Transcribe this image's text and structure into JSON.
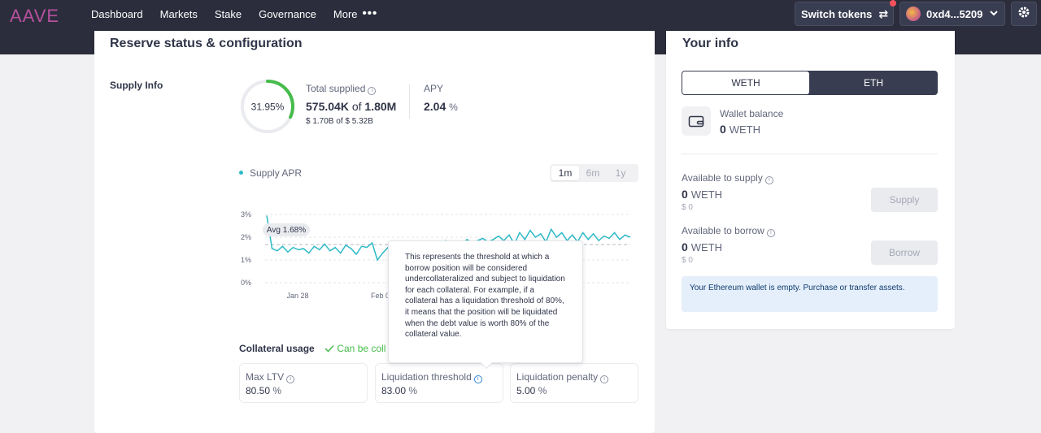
{
  "header": {
    "logo": "AAVE",
    "nav": [
      "Dashboard",
      "Markets",
      "Stake",
      "Governance"
    ],
    "more_label": "More",
    "switch_tokens_label": "Switch tokens",
    "wallet_address": "0xd4...5209"
  },
  "reserve": {
    "title": "Reserve status & configuration",
    "supply_info_label": "Supply Info",
    "utilization": "31.95%",
    "utilization_fraction": 0.3195,
    "total_supplied_label": "Total supplied",
    "total_supplied_amount": "575.04K",
    "of_label": "of",
    "total_supplied_cap": "1.80M",
    "usd_amount": "$ 1.70B",
    "usd_cap": "$ 5.32B",
    "apy_label": "APY",
    "apy_value": "2.04",
    "percent_sign": "%"
  },
  "chart_data": {
    "type": "line",
    "legend": "Supply APR",
    "ranges": [
      "1m",
      "6m",
      "1y"
    ],
    "selected_range": "1m",
    "y_ticks": [
      "3%",
      "2%",
      "1%",
      "0%"
    ],
    "ylim": [
      0,
      3
    ],
    "x_tick_labels": [
      "Jan 28",
      "Feb 0"
    ],
    "avg_label": "Avg 1.68%",
    "avg_value": 1.68,
    "series": [
      {
        "values": [
          2.95,
          1.5,
          1.4,
          1.6,
          1.35,
          1.55,
          1.45,
          1.5,
          1.3,
          1.6,
          1.45,
          1.7,
          1.4,
          1.55,
          1.3,
          1.65,
          1.5,
          1.25,
          1.6,
          1.55,
          1.75,
          1.0,
          1.3,
          1.55,
          1.7,
          1.4,
          1.6,
          1.5,
          1.7,
          1.45,
          1.65,
          1.8,
          1.5,
          1.75,
          1.85,
          1.6,
          1.8,
          1.7,
          1.9,
          1.75,
          1.85,
          1.95,
          1.8,
          1.9,
          2.05,
          1.85,
          2.1,
          1.7,
          2.2,
          1.9,
          2.3,
          2.0,
          2.15,
          1.8,
          2.35,
          2.0,
          2.2,
          1.85,
          2.1,
          1.8,
          2.2,
          1.9,
          2.15,
          1.85,
          2.05,
          1.95,
          2.2,
          1.9,
          2.1,
          2.0
        ]
      }
    ]
  },
  "tooltip": {
    "text": "This represents the threshold at which a borrow position will be considered undercollateralized and subject to liquidation for each collateral. For example, if a collateral has a liquidation threshold of 80%, it means that the position will be liquidated when the debt value is worth 80% of the collateral value."
  },
  "collateral": {
    "label": "Collateral usage",
    "status": "Can be coll",
    "max_ltv_label": "Max LTV",
    "max_ltv_value": "80.50",
    "liq_threshold_label": "Liquidation threshold",
    "liq_threshold_value": "83.00",
    "liq_penalty_label": "Liquidation penalty",
    "liq_penalty_value": "5.00"
  },
  "your_info": {
    "title": "Your info",
    "tabs": [
      "WETH",
      "ETH"
    ],
    "wallet_balance_label": "Wallet balance",
    "wallet_balance_value": "0",
    "token": "WETH",
    "available_supply_label": "Available to supply",
    "available_supply_value": "0",
    "available_supply_usd": "$ 0",
    "supply_button": "Supply",
    "available_borrow_label": "Available to borrow",
    "available_borrow_value": "0",
    "available_borrow_usd": "$ 0",
    "borrow_button": "Borrow",
    "notice": "Your Ethereum wallet is empty. Purchase or transfer assets."
  }
}
